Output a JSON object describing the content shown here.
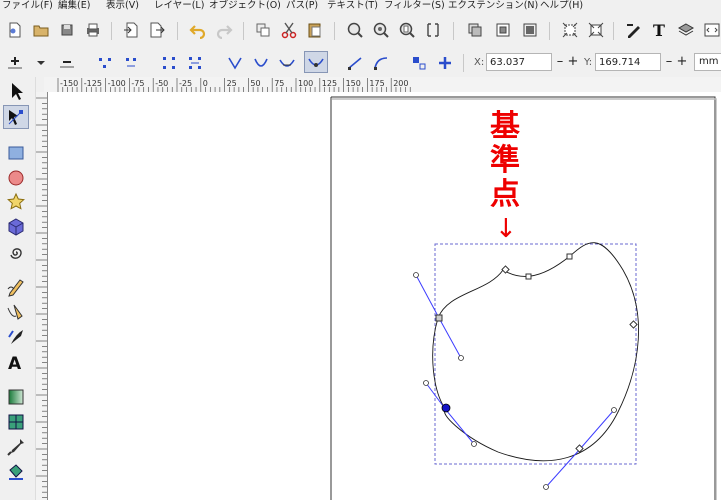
{
  "menu": [
    "ファイル(F)",
    "編集(E)",
    "表示(V)",
    "レイヤー(L)",
    "オブジェクト(O)",
    "パス(P)",
    "テキスト(T)",
    "フィルター(S)",
    "エクステンション(N)",
    "ヘルプ(H)"
  ],
  "coords": {
    "x_label": "X:",
    "x_value": "63.037",
    "y_label": "Y:",
    "y_value": "169.714",
    "minus": "–",
    "plus": "+",
    "unit": "mm"
  },
  "ruler": {
    "labels": [
      "-150",
      "-125",
      "-100",
      "-75",
      "-50",
      "-25",
      "0",
      "25",
      "50",
      "75",
      "100",
      "125",
      "150",
      "175",
      "200"
    ]
  },
  "annotation": {
    "lines": [
      "基",
      "準",
      "点"
    ],
    "arrow": "↓"
  },
  "icons": {
    "toolbar": [
      "new-document-icon",
      "open-document-icon",
      "save-document-icon",
      "print-icon",
      "import-icon",
      "export-icon",
      "undo-icon",
      "redo-icon",
      "duplicate-icon",
      "cut-icon",
      "paste-icon",
      "zoom-selection-icon",
      "zoom-drawing-icon",
      "zoom-page-icon",
      "zoom-fit-icon",
      "group-icon",
      "ungroup-icon",
      "clone-icon",
      "unclone-icon",
      "fill-stroke-icon",
      "text-font-icon",
      "layers-icon",
      "align-icon"
    ],
    "tools": [
      "selector-arrow-icon",
      "node-editor-icon",
      "rectangle-icon",
      "ellipse-icon",
      "star-icon",
      "box-3d-icon",
      "spiral-icon",
      "pencil-icon",
      "pen-bezier-icon",
      "calligraphy-icon",
      "text-tool-icon",
      "gradient-icon",
      "mesh-icon",
      "dropper-icon",
      "paint-bucket-icon"
    ]
  },
  "colors": {
    "annotation": "#ee0000",
    "path_stroke": "#1a1a1a",
    "handle_line": "#3d3dff",
    "bbox_dash": "#6a6ad0",
    "selected_node": "#1414c8"
  }
}
